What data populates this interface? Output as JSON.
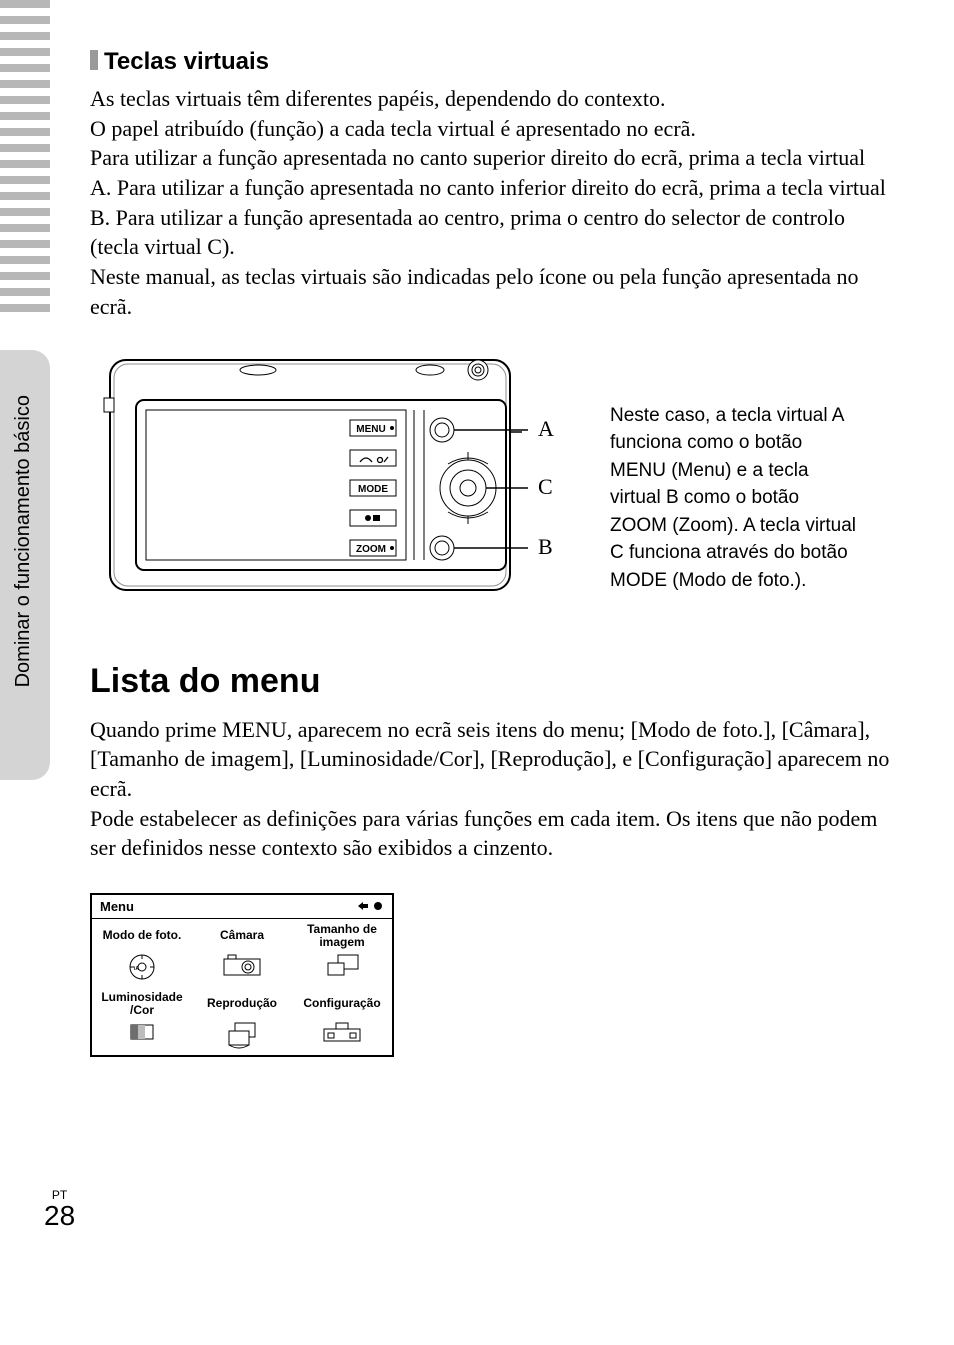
{
  "sideLabel": "Dominar o funcionamento básico",
  "section1": {
    "heading": "Teclas virtuais",
    "p1": "As teclas virtuais têm diferentes papéis, dependendo do contexto.",
    "p2": "O papel atribuído (função) a cada tecla virtual é apresentado no ecrã.",
    "p3": "Para utilizar a função apresentada no canto superior direito do ecrã, prima a tecla virtual A. Para utilizar a função apresentada no canto inferior direito do ecrã, prima a tecla virtual B. Para utilizar a função apresentada ao centro, prima o centro do selector de controlo (tecla virtual C).",
    "p4": "Neste manual, as teclas virtuais são indicadas pelo ícone ou pela função apresentada no ecrã."
  },
  "diagram": {
    "labelA": "A",
    "labelB": "B",
    "labelC": "C",
    "btnMenu": "MENU",
    "btnMode": "MODE",
    "btnZoom": "ZOOM",
    "caption": "Neste caso, a tecla virtual A funciona como o botão MENU (Menu) e a tecla virtual B como o botão ZOOM (Zoom). A tecla virtual C funciona através do botão MODE (Modo de foto.)."
  },
  "section2": {
    "heading": "Lista do menu",
    "p1": "Quando prime MENU, aparecem no ecrã seis itens do menu; [Modo de foto.], [Câmara], [Tamanho de imagem], [Luminosidade/Cor], [Reprodução], e [Configuração] aparecem no ecrã.",
    "p2": "Pode estabelecer as definições para várias funções em cada item. Os itens que não podem ser definidos nesse contexto são exibidos a cinzento."
  },
  "menuFig": {
    "title": "Menu",
    "items": [
      "Modo de foto.",
      "Câmara",
      "Tamanho de imagem",
      "Luminosidade /Cor",
      "Reprodução",
      "Configuração"
    ]
  },
  "footer": {
    "lang": "PT",
    "page": "28"
  }
}
